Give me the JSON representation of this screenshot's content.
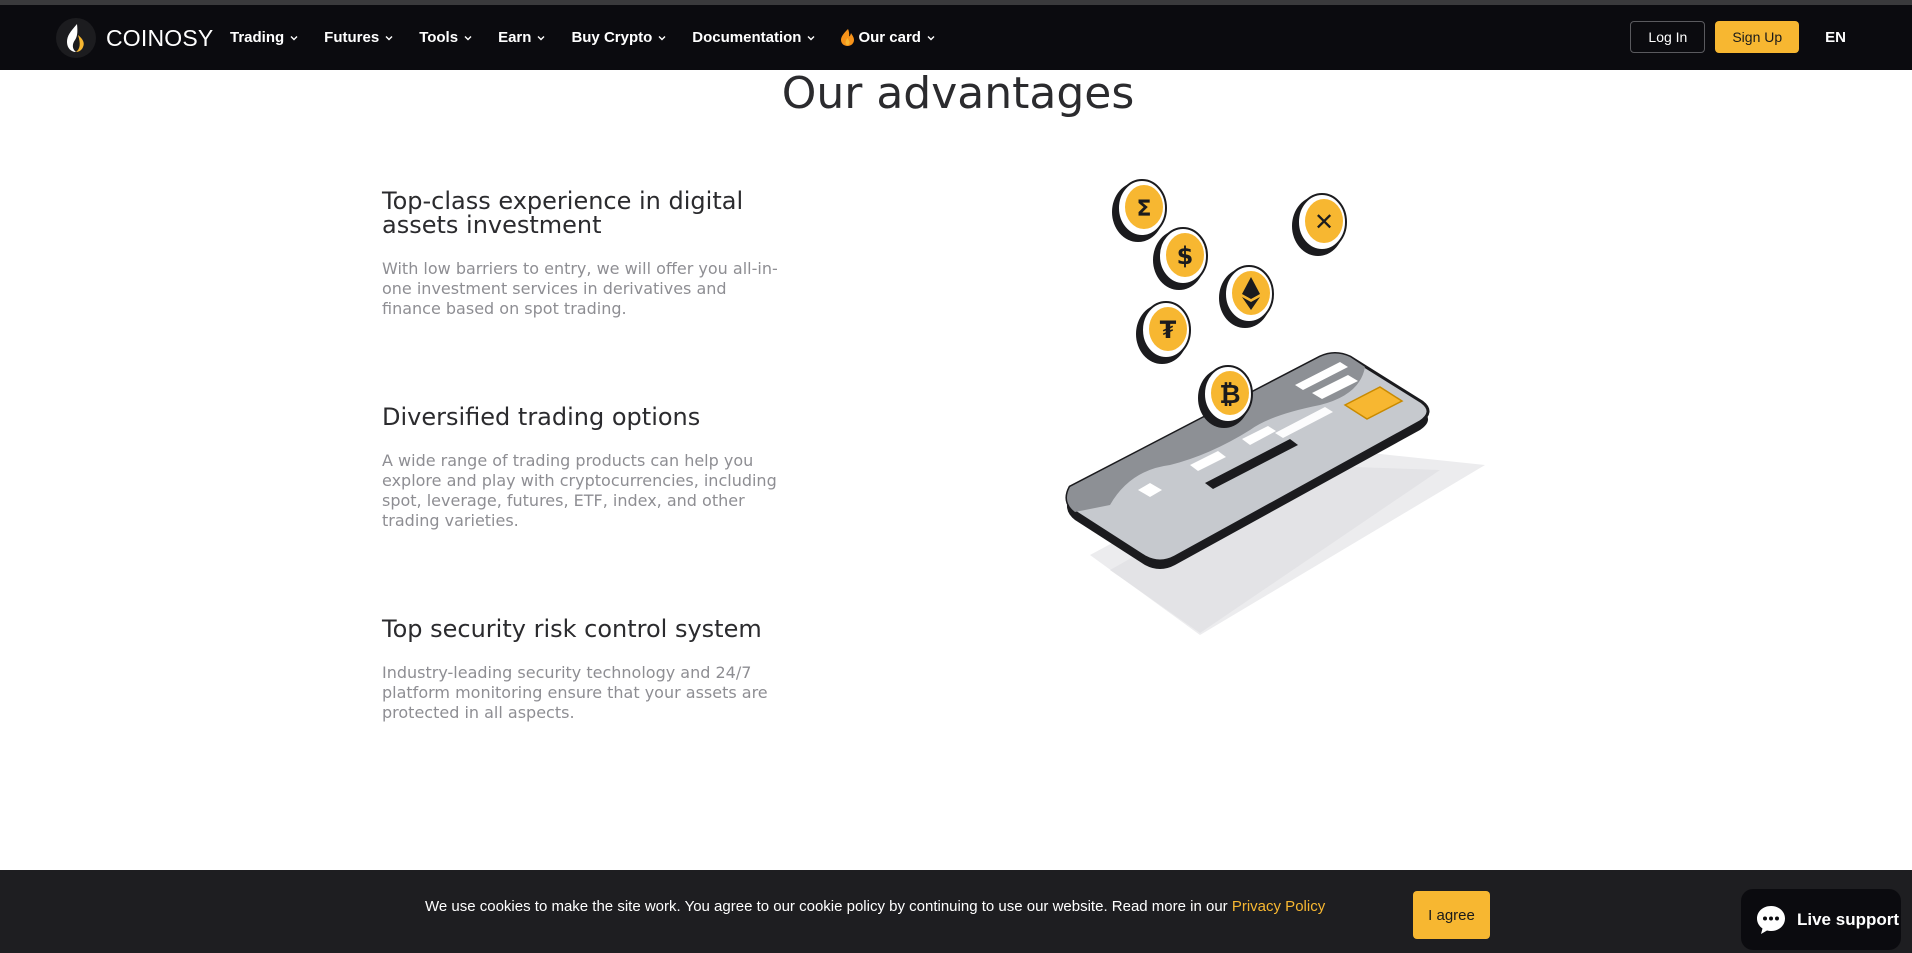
{
  "brand": {
    "name": "COINOSY"
  },
  "nav": {
    "items": [
      {
        "label": "Trading"
      },
      {
        "label": "Futures"
      },
      {
        "label": "Tools"
      },
      {
        "label": "Earn"
      },
      {
        "label": "Buy Crypto"
      },
      {
        "label": "Documentation"
      },
      {
        "label": "Our card"
      }
    ],
    "login_label": "Log In",
    "signup_label": "Sign Up",
    "language": "EN"
  },
  "main": {
    "title": "Our advantages",
    "features": [
      {
        "heading": "Top-class experience in digital assets investment",
        "text": "With low barriers to entry, we will offer you all-in-one investment services in derivatives and finance based on spot trading."
      },
      {
        "heading": "Diversified trading options",
        "text": "A wide range of trading products can help you explore and play with cryptocurrencies, including spot, leverage, futures, ETF, index, and other trading varieties."
      },
      {
        "heading": "Top security risk control system",
        "text": "Industry-leading security technology and 24/7 platform monitoring ensure that your assets are protected in all aspects."
      }
    ]
  },
  "cookie": {
    "text": "We use cookies to make the site work. You agree to our cookie policy by continuing to use our website. Read more in our ",
    "link_label": "Privacy Policy",
    "agree_label": "I agree"
  },
  "support": {
    "label": "Live support"
  },
  "colors": {
    "accent": "#f7b731",
    "navbar": "#0b0b0f",
    "cookie_bg": "#1e1e21"
  }
}
